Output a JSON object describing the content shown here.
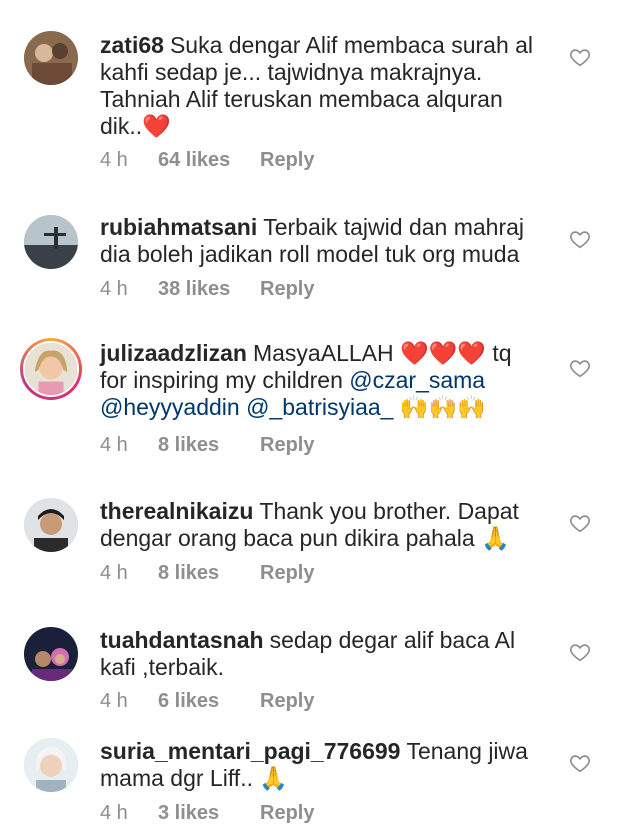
{
  "comments": [
    {
      "username": "zati68",
      "text": "Suka dengar Alif membaca surah al kahfi sedap je... tajwidnya makrajnya. Tahniah Alif teruskan membaca alquran dik..",
      "emoji": "❤️",
      "time": "4 h",
      "likes": "64 likes",
      "reply": "Reply"
    },
    {
      "username": "rubiahmatsani",
      "text": "Terbaik tajwid dan mahraj dia boleh jadikan roll model tuk org muda",
      "time": "4 h",
      "likes": "38 likes",
      "reply": "Reply"
    },
    {
      "username": "julizaadzlizan",
      "text_before": "MasyaALLAH",
      "emoji_a": "❤️❤️❤️",
      "text_middle": "tq for inspiring my children",
      "mention1": "@czar_sama",
      "mention2": "@heyyyaddin",
      "mention3": "@_batrisyiaa_",
      "emoji_b": "🙌🙌🙌",
      "time": "4 h",
      "likes": "8 likes",
      "reply": "Reply"
    },
    {
      "username": "therealnikaizu",
      "text": "Thank you brother. Dapat dengar orang baca pun dikira pahala",
      "emoji": "🙏",
      "time": "4 h",
      "likes": "8 likes",
      "reply": "Reply"
    },
    {
      "username": "tuahdantasnah",
      "text": "sedap degar alif baca Al kafi ,terbaik.",
      "time": "4 h",
      "likes": "6 likes",
      "reply": "Reply"
    },
    {
      "username": "suria_mentari_pagi_776699",
      "text": "Tenang jiwa mama dgr Liff..",
      "emoji": "🙏",
      "time": "4 h",
      "likes": "3 likes",
      "reply": "Reply"
    }
  ]
}
